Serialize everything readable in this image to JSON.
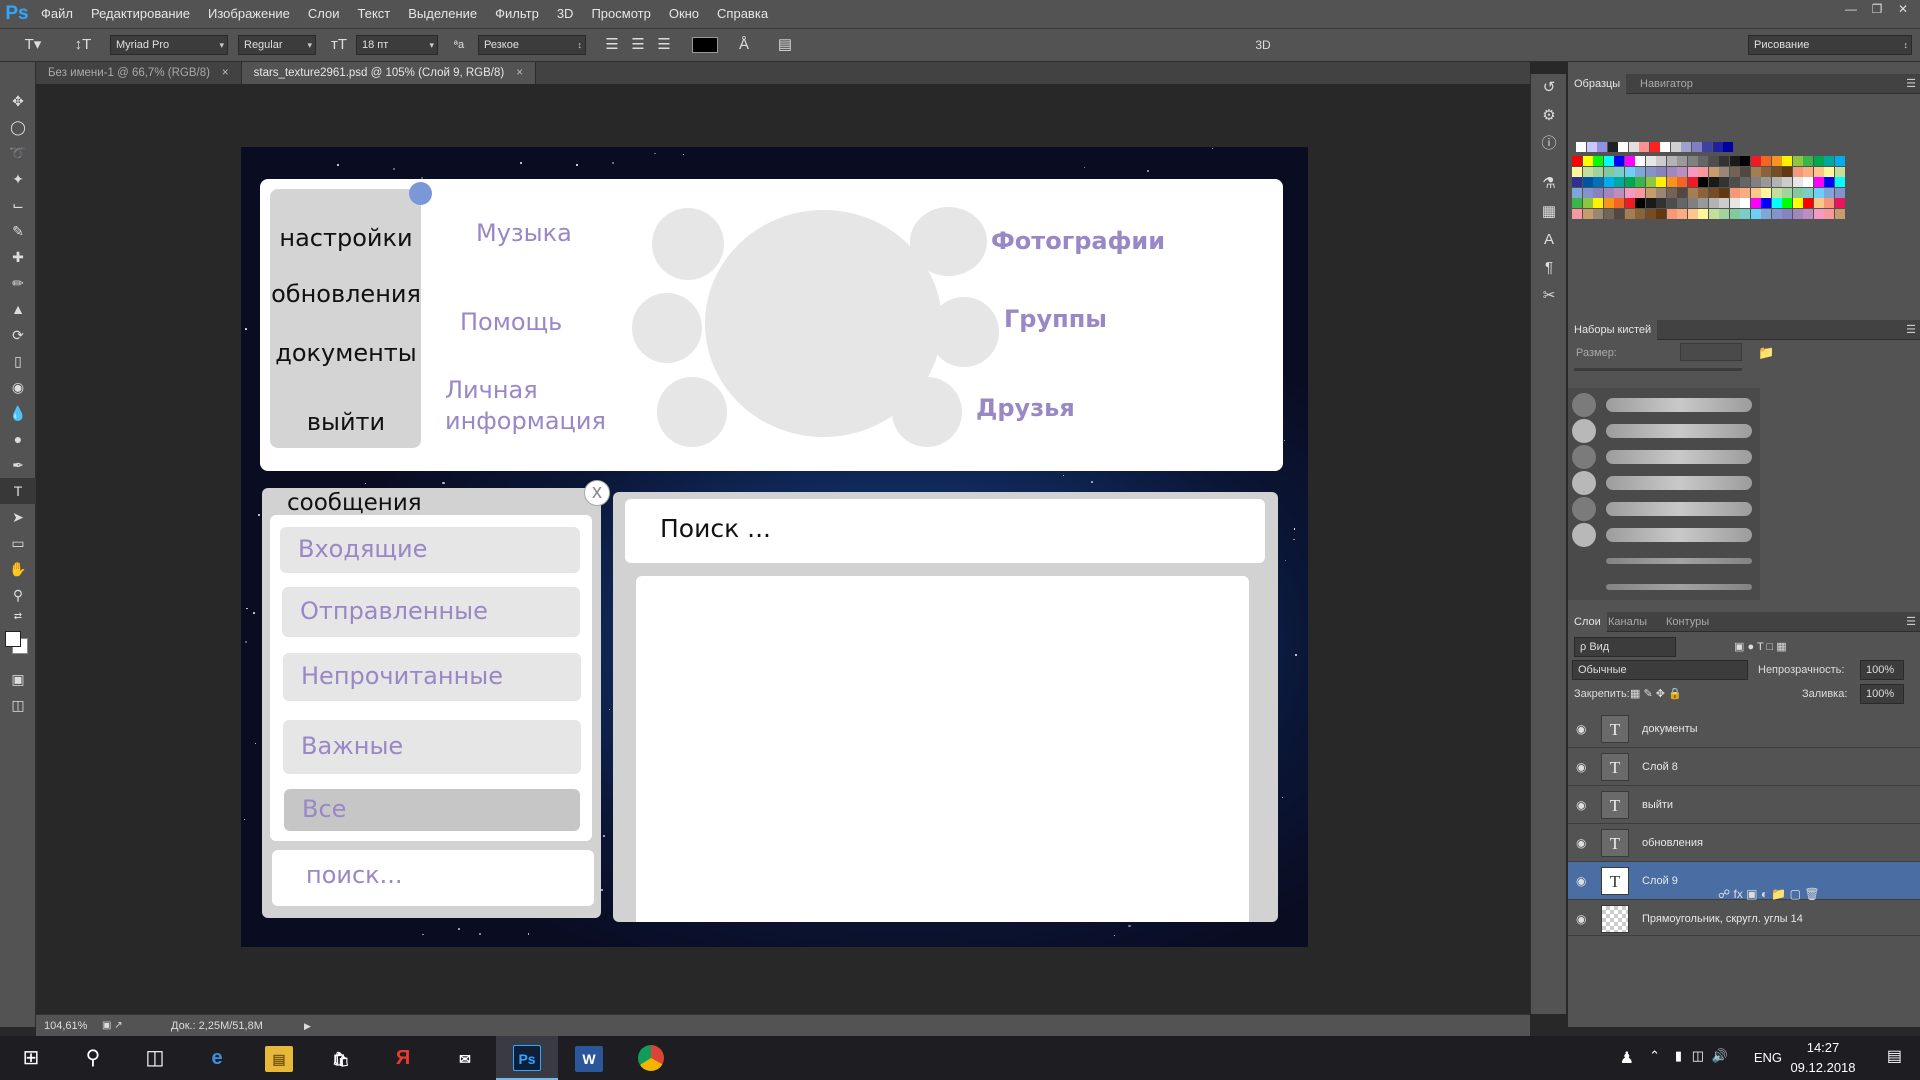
{
  "menubar": {
    "logo": "Ps",
    "items": [
      "Файл",
      "Редактирование",
      "Изображение",
      "Слои",
      "Текст",
      "Выделение",
      "Фильтр",
      "3D",
      "Просмотр",
      "Окно",
      "Справка"
    ]
  },
  "options": {
    "font_family": "Myriad Pro",
    "font_style": "Regular",
    "font_size": "18 пт",
    "aa_label": "ªa",
    "antialias": "Резкое",
    "mode_3d": "3D",
    "workspace": "Рисование",
    "text_color": "#000000"
  },
  "doc_tabs": [
    {
      "label": "Без имени-1 @ 66,7% (RGB/8)",
      "close": "×"
    },
    {
      "label": "stars_texture2961.psd @ 105% (Слой 9, RGB/8)",
      "close": "×"
    }
  ],
  "canvas": {
    "top_menu": [
      "настройки",
      "обновления",
      "документы",
      "выйти"
    ],
    "labels": {
      "music": "Музыка",
      "photos": "Фотографии",
      "help": "Помощь",
      "groups": "Группы",
      "personal_info": "Личная информация",
      "friends": "Друзья"
    },
    "messages": {
      "title": "сообщения",
      "close": "x",
      "items": [
        "Входящие",
        "Отправленные",
        "Непрочитанные",
        "Важные",
        "Все"
      ],
      "selected_index": 4,
      "search": "поиск..."
    },
    "search_bar": "Поиск ..."
  },
  "status": {
    "zoom": "104,61%",
    "doc": "Док.: 2,25M/51,8M"
  },
  "panels": {
    "swatches_tabs": [
      "Образцы",
      "Навигатор"
    ],
    "brush_title": "Наборы кистей",
    "brush_size_label": "Размер:",
    "layers_tabs": [
      "Слои",
      "Каналы",
      "Контуры"
    ],
    "filter_label": "ρ Вид",
    "blend_mode": "Обычные",
    "opacity_label": "Непрозрачность:",
    "opacity_value": "100%",
    "lock_label": "Закрепить:",
    "fill_label": "Заливка:",
    "fill_value": "100%",
    "layers": [
      {
        "name": "документы",
        "type": "text",
        "selected": false
      },
      {
        "name": "Слой 8",
        "type": "text",
        "selected": false
      },
      {
        "name": "выйти",
        "type": "text",
        "selected": false
      },
      {
        "name": "обновления",
        "type": "text",
        "selected": false
      },
      {
        "name": "Слой 9",
        "type": "text",
        "selected": true
      },
      {
        "name": "Прямоугольник, скругл. углы 14",
        "type": "shape",
        "selected": false
      }
    ]
  },
  "taskbar": {
    "lang": "ENG",
    "time": "14:27",
    "date": "09.12.2018"
  }
}
